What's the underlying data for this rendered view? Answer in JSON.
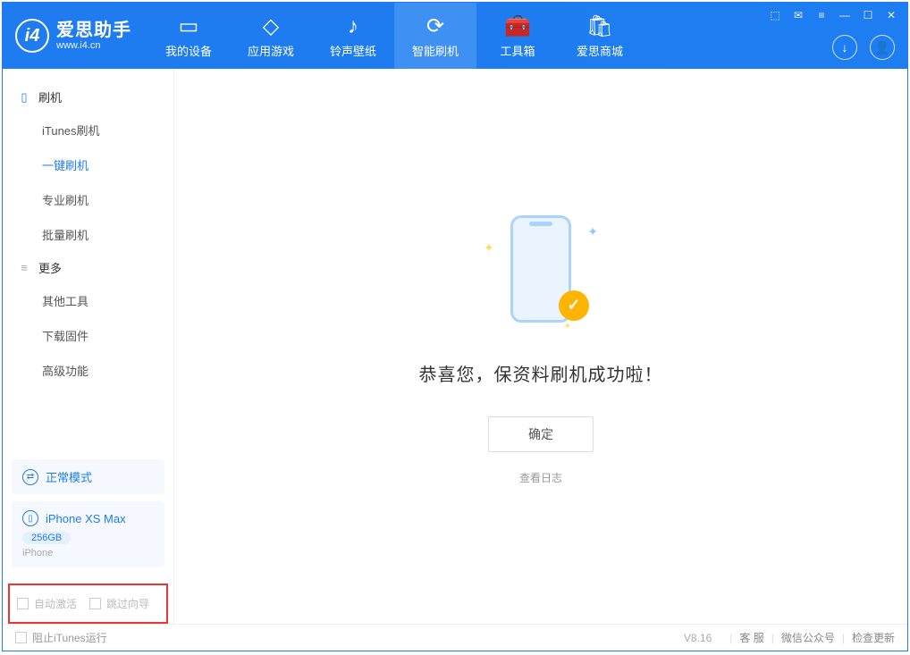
{
  "app": {
    "title": "爱思助手",
    "subtitle": "www.i4.cn"
  },
  "nav": {
    "device": "我的设备",
    "apps": "应用游戏",
    "ring": "铃声壁纸",
    "flash": "智能刷机",
    "tools": "工具箱",
    "store": "爱思商城"
  },
  "sidebar": {
    "group_flash": "刷机",
    "items_flash": {
      "itunes": "iTunes刷机",
      "onekey": "一键刷机",
      "pro": "专业刷机",
      "batch": "批量刷机"
    },
    "group_more": "更多",
    "items_more": {
      "other": "其他工具",
      "firmware": "下载固件",
      "advanced": "高级功能"
    },
    "mode_panel": "正常模式",
    "device_name": "iPhone XS Max",
    "device_storage": "256GB",
    "device_type": "iPhone",
    "auto_activate": "自动激活",
    "skip_guide": "跳过向导"
  },
  "main": {
    "success": "恭喜您，保资料刷机成功啦！",
    "ok": "确定",
    "view_log": "查看日志"
  },
  "footer": {
    "block_itunes": "阻止iTunes运行",
    "version": "V8.16",
    "support": "客 服",
    "wechat": "微信公众号",
    "update": "检查更新"
  }
}
